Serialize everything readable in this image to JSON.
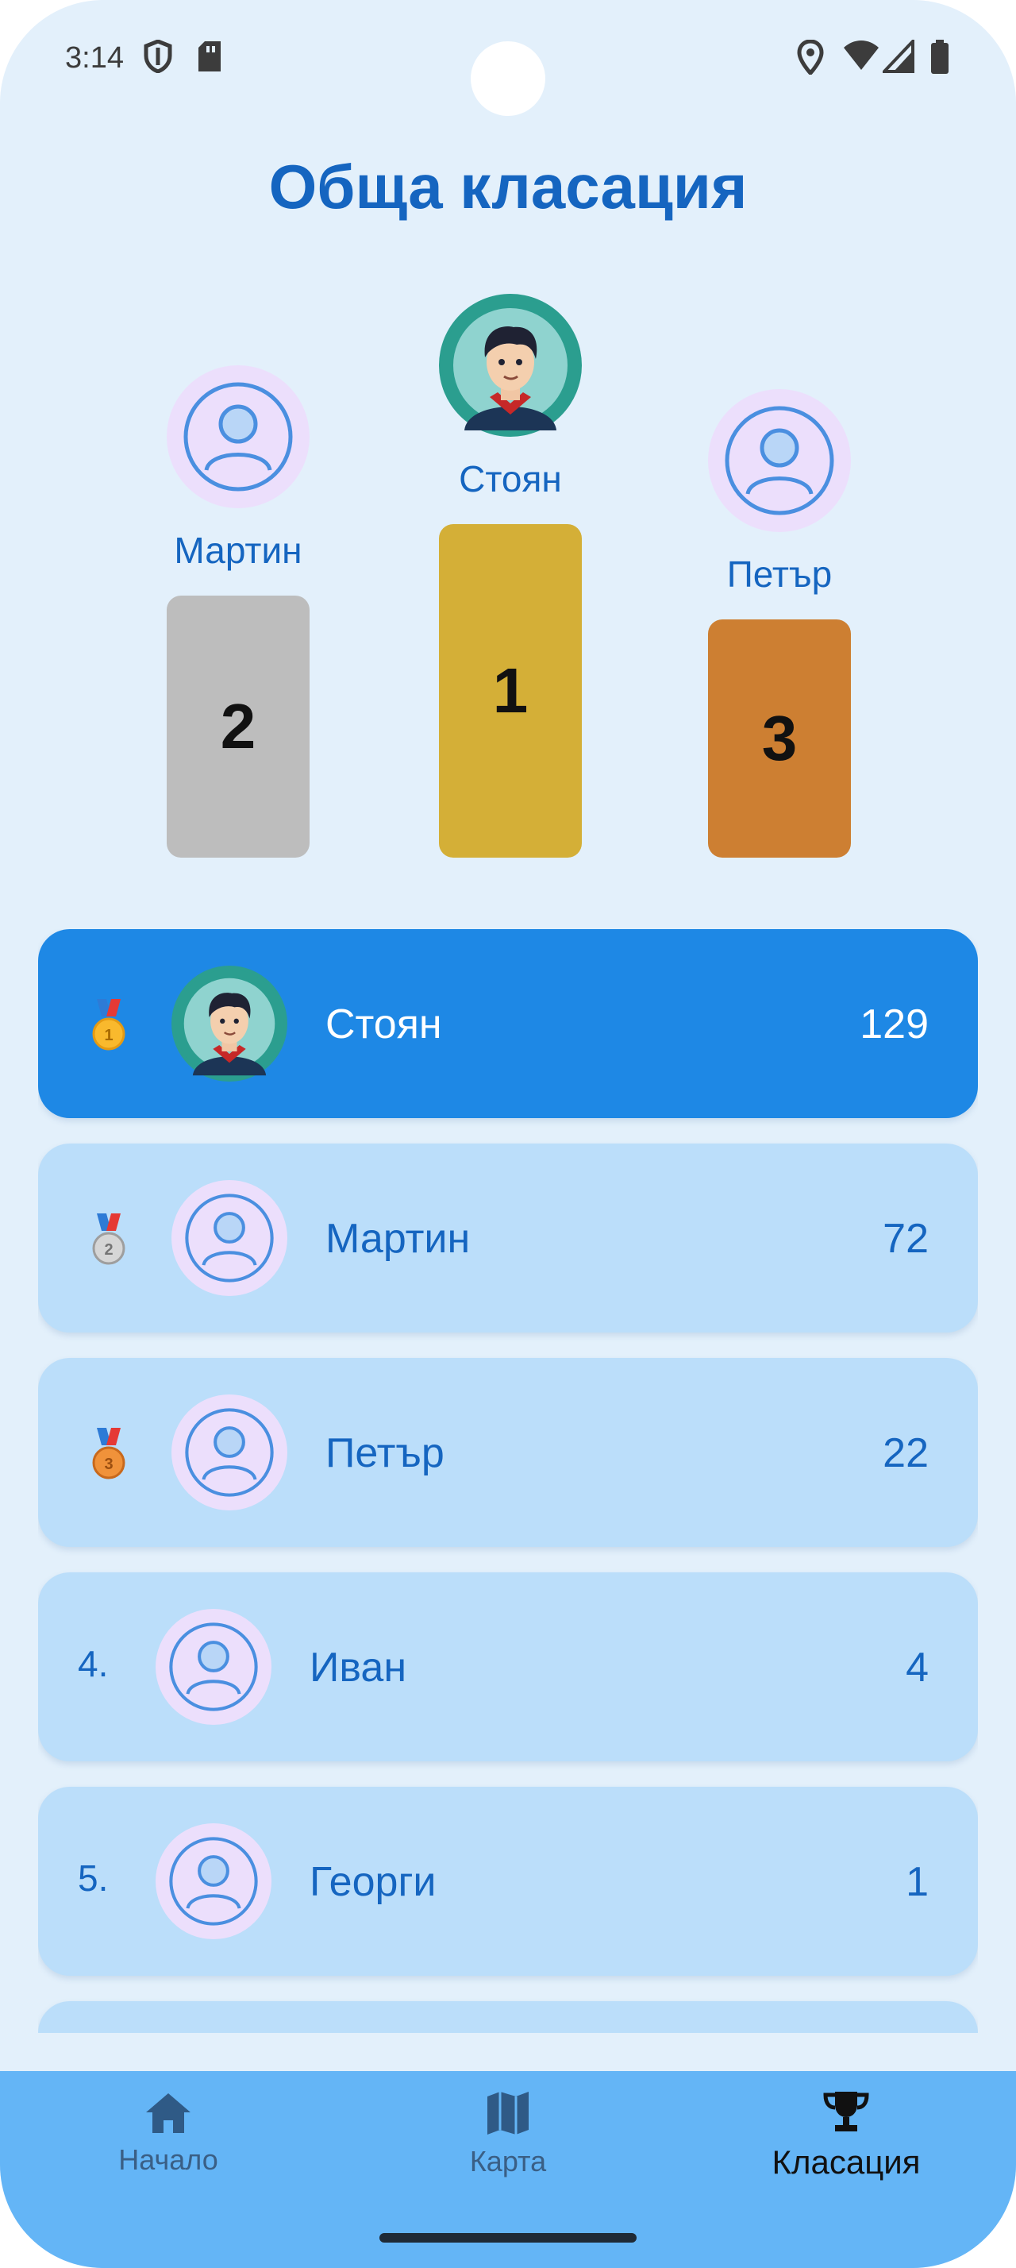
{
  "status_bar": {
    "time": "3:14",
    "icons": [
      "shield-icon",
      "sd-card-icon",
      "location-icon",
      "wifi-icon",
      "signal-icon",
      "battery-icon"
    ]
  },
  "title": "Обща класация",
  "podium": {
    "first": {
      "name": "Стоян",
      "place": "1",
      "color": "#d4af37"
    },
    "second": {
      "name": "Мартин",
      "place": "2",
      "color": "#bdbdbd"
    },
    "third": {
      "name": "Петър",
      "place": "3",
      "color": "#cd7f32"
    }
  },
  "ranking": [
    {
      "rank": "gold-medal-icon",
      "name": "Стоян",
      "score": "129",
      "avatar": "person-avatar"
    },
    {
      "rank": "silver-medal-icon",
      "name": "Мартин",
      "score": "72",
      "avatar": "default-user-icon"
    },
    {
      "rank": "bronze-medal-icon",
      "name": "Петър",
      "score": "22",
      "avatar": "default-user-icon"
    },
    {
      "rank": "4.",
      "name": "Иван",
      "score": "4",
      "avatar": "default-user-icon"
    },
    {
      "rank": "5.",
      "name": "Георги",
      "score": "1",
      "avatar": "default-user-icon"
    }
  ],
  "nav": {
    "home": "Начало",
    "map": "Карта",
    "ranking": "Класация",
    "active": "ranking"
  },
  "colors": {
    "accent": "#1565c0",
    "highlight_row": "#1e88e5",
    "row": "#bbdefa",
    "background": "#e3f0fb",
    "nav_bar": "#64b5f6"
  }
}
